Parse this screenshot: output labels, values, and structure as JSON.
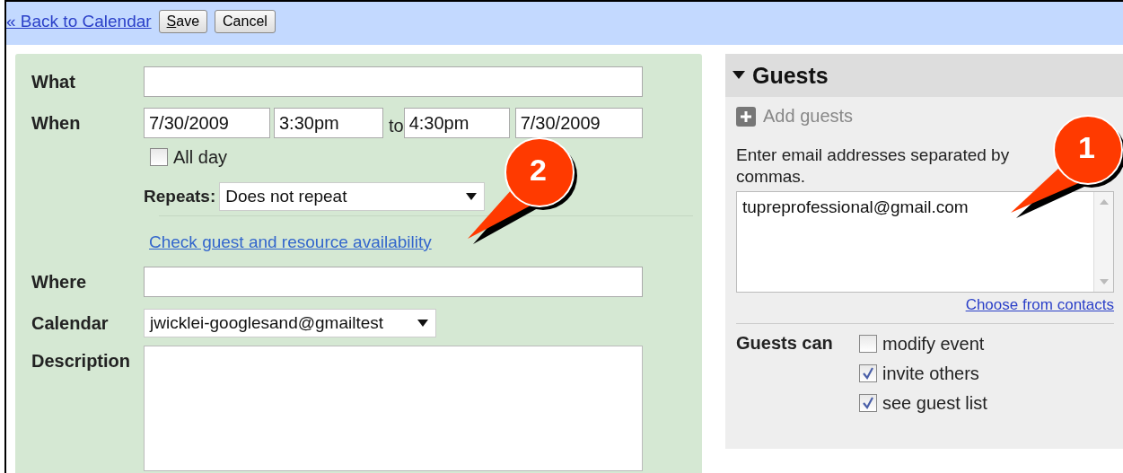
{
  "toolbar": {
    "back_link": "« Back to Calendar",
    "buttons": [
      "Save",
      "Cancel"
    ]
  },
  "event_form": {
    "what": {
      "label": "What"
    },
    "when": {
      "label": "When",
      "start_date": "7/30/2009",
      "start_time": "3:30pm",
      "separator": "to",
      "end_time": "4:30pm",
      "end_date": "7/30/2009"
    },
    "all_day": {
      "label": "All day",
      "checked": false
    },
    "repeats": {
      "label": "Repeats:",
      "value": "Does not repeat"
    },
    "availability_link": "Check guest and resource availability",
    "where": {
      "label": "Where"
    },
    "calendar": {
      "label": "Calendar",
      "value": "jwicklei-googlesand@gmailtest"
    },
    "description": {
      "label": "Description"
    }
  },
  "guests": {
    "title": "Guests",
    "expanded": true,
    "add_guests": "Add guests",
    "hint": "Enter email addresses separated by commas.",
    "value": "tupreprofessional@gmail.com",
    "contacts_link": "Choose from contacts",
    "permissions_label": "Guests can",
    "permissions": [
      {
        "label": "modify event",
        "checked": false
      },
      {
        "label": "invite others",
        "checked": true
      },
      {
        "label": "see guest list",
        "checked": true
      }
    ]
  },
  "callouts": [
    {
      "label": "2"
    },
    {
      "label": "1"
    }
  ]
}
